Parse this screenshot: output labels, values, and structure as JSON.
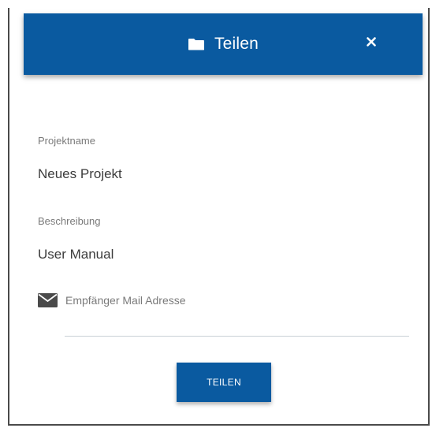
{
  "dialog": {
    "title": "Teilen",
    "title_icon": "folder-icon",
    "close_icon": "close-icon",
    "header_color": "#0a5aa0"
  },
  "fields": {
    "project_name_label": "Projektname",
    "project_name_value": "Neues Projekt",
    "description_label": "Beschreibung",
    "description_value": "User Manual"
  },
  "email": {
    "icon": "mail-icon",
    "placeholder": "Empfänger Mail Adresse",
    "value": ""
  },
  "actions": {
    "submit_label": "TEILEN"
  }
}
